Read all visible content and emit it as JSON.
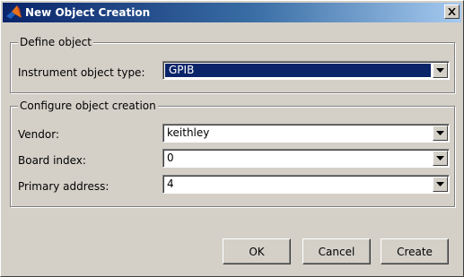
{
  "window": {
    "title": "New Object Creation",
    "close_glyph": "×"
  },
  "define_object": {
    "legend": "Define object",
    "instrument_type_label": "Instrument object type:",
    "instrument_type_value": "GPIB"
  },
  "configure": {
    "legend": "Configure object creation",
    "vendor_label": "Vendor:",
    "vendor_value": "keithley",
    "board_index_label": "Board index:",
    "board_index_value": "0",
    "primary_address_label": "Primary address:",
    "primary_address_value": "4"
  },
  "buttons": {
    "ok": "OK",
    "cancel": "Cancel",
    "create": "Create"
  },
  "icons": {
    "title": "matlab-logo-icon",
    "dropdown": "chevron-down-icon"
  },
  "colors": {
    "selection": "#0a246a",
    "titlebar_start": "#0a246a",
    "titlebar_end": "#a6caf0",
    "dialog_face": "#d4d0c8"
  }
}
